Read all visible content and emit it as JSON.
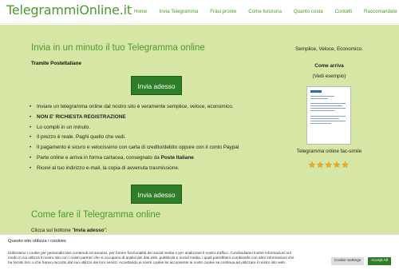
{
  "header": {
    "logo": "TelegrammiOnline.it",
    "nav": [
      "Home",
      "Invia Telegramma",
      "Frasi pronte",
      "Come funziona",
      "Quanto costa",
      "Contatti",
      "Raccomandate"
    ]
  },
  "main": {
    "title": "Invia in un minuto il tuo Telegramma online",
    "subtitle": "Tramite PosteItaliane",
    "button_label": "Invia adesso",
    "bullets": [
      {
        "pre": "Inviare un telegramma online dal nostro sito è veramente semplice, veloce, economico.",
        "bold": "",
        "post": ""
      },
      {
        "pre": "",
        "bold": "NON E' RICHIESTA REGISTRAZIONE",
        "post": ""
      },
      {
        "pre": "Lo compili in un minuto.",
        "bold": "",
        "post": ""
      },
      {
        "pre": "Il prezzo è reale. Paghi quello che vedi.",
        "bold": "",
        "post": ""
      },
      {
        "pre": "Il pagamento è sicuro e velocissimo con carta di credito/debito oppure con il conto Paypal",
        "bold": "",
        "post": ""
      },
      {
        "pre": "Parte online e arriva in forma cartacea, consegnato da ",
        "bold": "Poste Italiane",
        "post": ""
      },
      {
        "pre": "Ricevi al tuo indirizzo e-mail, la copia di avvenuta trasmissione.",
        "bold": "",
        "post": ""
      }
    ],
    "button2_label": "Invia adesso",
    "section2_title": "Come fare il Telegramma online",
    "section2_text_pre": "Clicca sul bottone \"",
    "section2_text_bold": "Invia adesso",
    "section2_text_post": "\":"
  },
  "side": {
    "tagline": "Semplice, Veloce, Economico.",
    "how_title": "Come arriva",
    "how_sub": "(Vedi esempio)",
    "caption": "Telegramma online fac-simile",
    "rating_stars": 5
  },
  "cookie": {
    "title": "Questo sito utilizza i cookies",
    "body": "Utilizziamo i cookie per personalizzare contenuti ed annunci, per fornire funzionalità dei social media e per analizzare il nostro traffico. Condividiamo inoltre informazioni sul modo in cui utilizza il nostro sito con i nostri partner che si occupano di analisi dei dati web, pubblicità e social media, i quali potrebbero combinarle con altre informazioni che ha fornito loro o che hanno raccolto dal suo utilizzo dei loro servizi. Accettando ai nostri cookie lei acconsente ai nostri cookie se continua ad utilizzare il nostro sito web.",
    "settings_label": "Cookie Settings",
    "accept_label": "Accept All"
  },
  "colors": {
    "brand_green": "#4a9a2e",
    "button_green": "#2e7d27",
    "panel_bg": "#d6e6a4",
    "star": "#f2a81c"
  }
}
